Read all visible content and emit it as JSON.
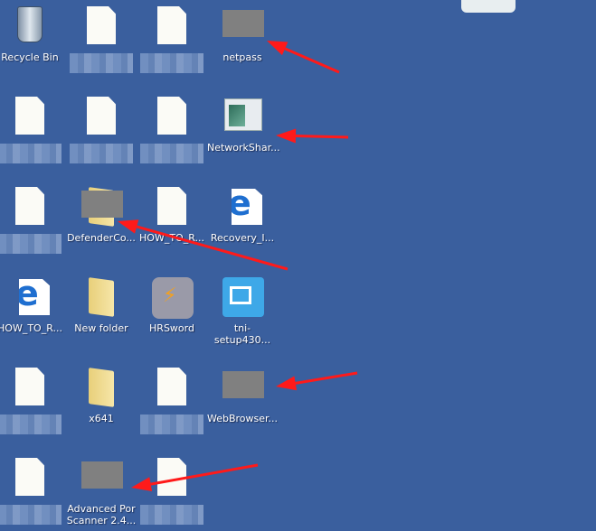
{
  "desktop": {
    "icons": [
      {
        "type": "recycle-bin",
        "label": "Recycle Bin"
      },
      {
        "type": "document",
        "label": null
      },
      {
        "type": "document",
        "label": null
      },
      {
        "type": "redacted",
        "label": "netpass"
      },
      {
        "type": "document",
        "label": null
      },
      {
        "type": "document",
        "label": null
      },
      {
        "type": "document",
        "label": null
      },
      {
        "type": "app-window",
        "label": "NetworkShar..."
      },
      {
        "type": "document",
        "label": null
      },
      {
        "type": "folder-redacted",
        "label": "DefenderCo..."
      },
      {
        "type": "document",
        "label": "HOW_TO_R..."
      },
      {
        "type": "ie-document",
        "label": "Recovery_I..."
      },
      {
        "type": "ie-document",
        "label": "HOW_TO_R..."
      },
      {
        "type": "folder",
        "label": "New folder"
      },
      {
        "type": "hrsword",
        "label": "HRSword"
      },
      {
        "type": "tni",
        "label": "tni-setup430..."
      },
      {
        "type": "document",
        "label": null
      },
      {
        "type": "folder",
        "label": "x641"
      },
      {
        "type": "document",
        "label": null
      },
      {
        "type": "redacted",
        "label": "WebBrowser..."
      },
      {
        "type": "document",
        "label": null
      },
      {
        "type": "redacted",
        "label": "Advanced Por\nScanner 2.4..."
      },
      {
        "type": "document",
        "label": null
      }
    ]
  },
  "annotation_color": "#ff1a1a"
}
